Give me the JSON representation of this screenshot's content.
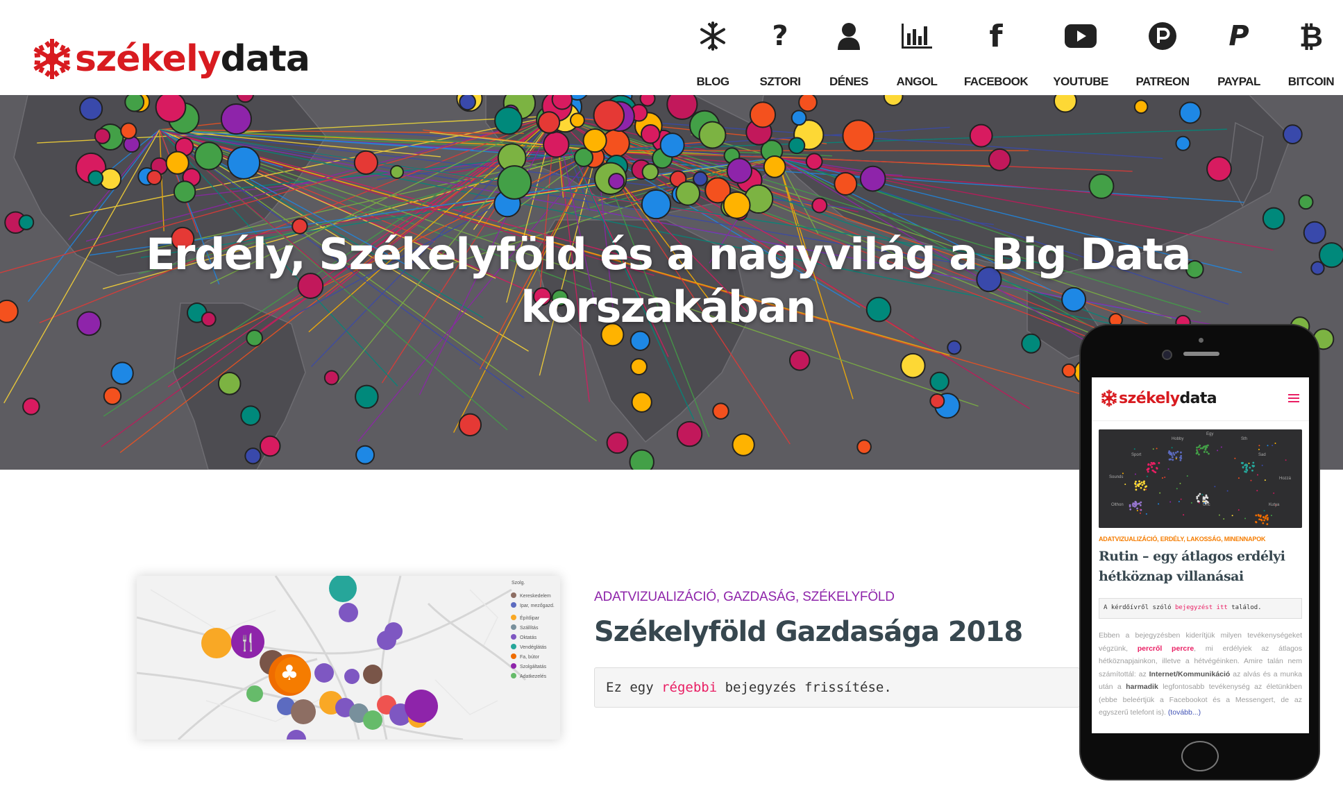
{
  "brand": {
    "logo_red": "székely",
    "logo_dark": "data",
    "red_color": "#d81b20"
  },
  "nav": [
    {
      "label": "BLOG",
      "icon": "snowflake-icon"
    },
    {
      "label": "SZTORI",
      "icon": "question-icon"
    },
    {
      "label": "DÉNES",
      "icon": "user-icon"
    },
    {
      "label": "ANGOL",
      "icon": "bar-chart-icon"
    },
    {
      "label": "FACEBOOK",
      "icon": "facebook-icon"
    },
    {
      "label": "YOUTUBE",
      "icon": "youtube-icon"
    },
    {
      "label": "PATREON",
      "icon": "patreon-icon"
    },
    {
      "label": "PAYPAL",
      "icon": "paypal-icon"
    },
    {
      "label": "BITCOIN",
      "icon": "bitcoin-icon"
    }
  ],
  "hero": {
    "title_line1": "Erdély, Székelyföld és a nagyvilág a Big Data",
    "title_line2": "korszakában"
  },
  "post": {
    "categories": "ADATVIZUALIZÁCIÓ, GAZDASÁG, SZÉKELYFÖLD",
    "title": "Székelyföld Gazdasága 2018",
    "note_before": "Ez egy ",
    "note_link": "régebbi",
    "note_after": " bejegyzés frissítése."
  },
  "mobile": {
    "categories": "ADATVIZUALIZÁCIÓ, ERDÉLY, LAKOSSÁG, MINENNAPOK",
    "title": "Rutin – egy átlagos erdélyi hétköznap villanásai",
    "note_before": "A kérdőívről szóló ",
    "note_link": "bejegyzést itt",
    "note_after": " találod.",
    "body_1": "Ebben a bejegyzésben kiderítjük milyen tevékenységeket végzünk, ",
    "body_pink": "percről percre",
    "body_2": ", mi erdélyiek az átlagos hétköznapjainkon, illetve a hétvégéinken. Amire talán nem számítottál: az ",
    "body_bold1": "Internet/Kommunikáció",
    "body_3": " az alvás és a munka után a ",
    "body_bold2": "harmadik",
    "body_4": " legfontosabb tevékenység az életünkben (ebbe beleértjük a Facebookot és a Messengert, de az egyszerű telefont is).",
    "more": "(tovább...)"
  }
}
